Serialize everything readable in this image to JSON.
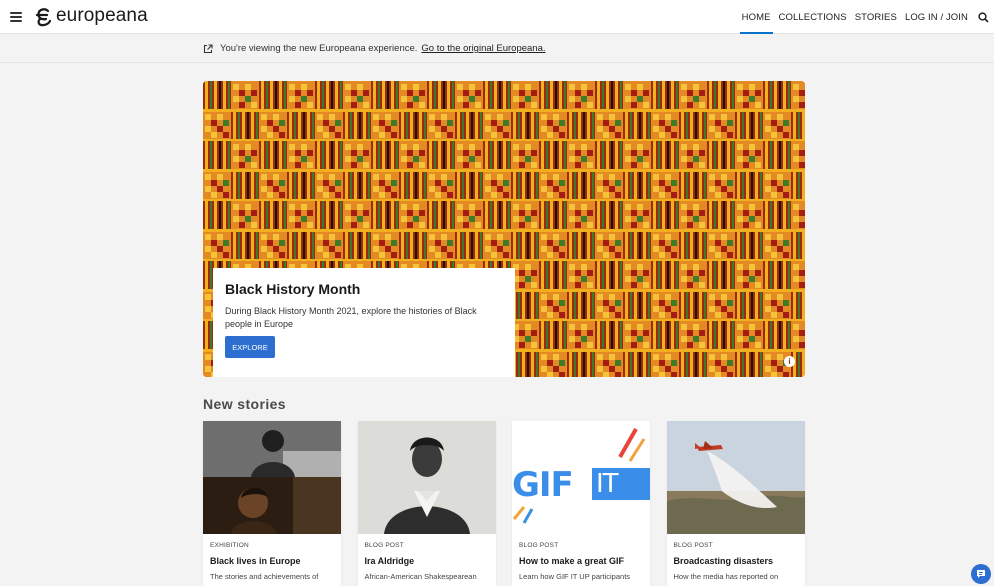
{
  "header": {
    "logo_text": "europeana",
    "nav": [
      {
        "label": "HOME",
        "active": true
      },
      {
        "label": "COLLECTIONS",
        "active": false
      },
      {
        "label": "STORIES",
        "active": false
      },
      {
        "label": "LOG IN / JOIN",
        "active": false
      }
    ],
    "icons": {
      "menu": "hamburger-menu-icon",
      "search": "search-icon"
    }
  },
  "notice": {
    "text": "You're viewing the new Europeana experience.",
    "link": "Go to the original Europeana.",
    "icon": "external-link-icon"
  },
  "hero": {
    "title": "Black History Month",
    "description": "During Black History Month 2021, explore the histories of Black people in Europe",
    "button": "EXPLORE",
    "info_icon": "i"
  },
  "new_stories": {
    "title": "New stories",
    "cards": [
      {
        "type": "EXHIBITION",
        "title": "Black lives in Europe",
        "description": "The stories and achievements of"
      },
      {
        "type": "BLOG POST",
        "title": "Ira Aldridge",
        "description": "African-American Shakespearean"
      },
      {
        "type": "BLOG POST",
        "title": "How to make a great GIF",
        "description": "Learn how GIF IT UP participants"
      },
      {
        "type": "BLOG POST",
        "title": "Broadcasting disasters",
        "description": "How the media has reported on"
      }
    ],
    "gif_banner": {
      "left": "GIF",
      "right": "IT UP"
    }
  },
  "colors": {
    "accent": "#2d6ed1",
    "active_underline": "#0a72cc",
    "kente_orange": "#e07a1c",
    "kente_yellow": "#f2b01e",
    "kente_green": "#3f7a2a",
    "kente_red": "#a51d12"
  }
}
